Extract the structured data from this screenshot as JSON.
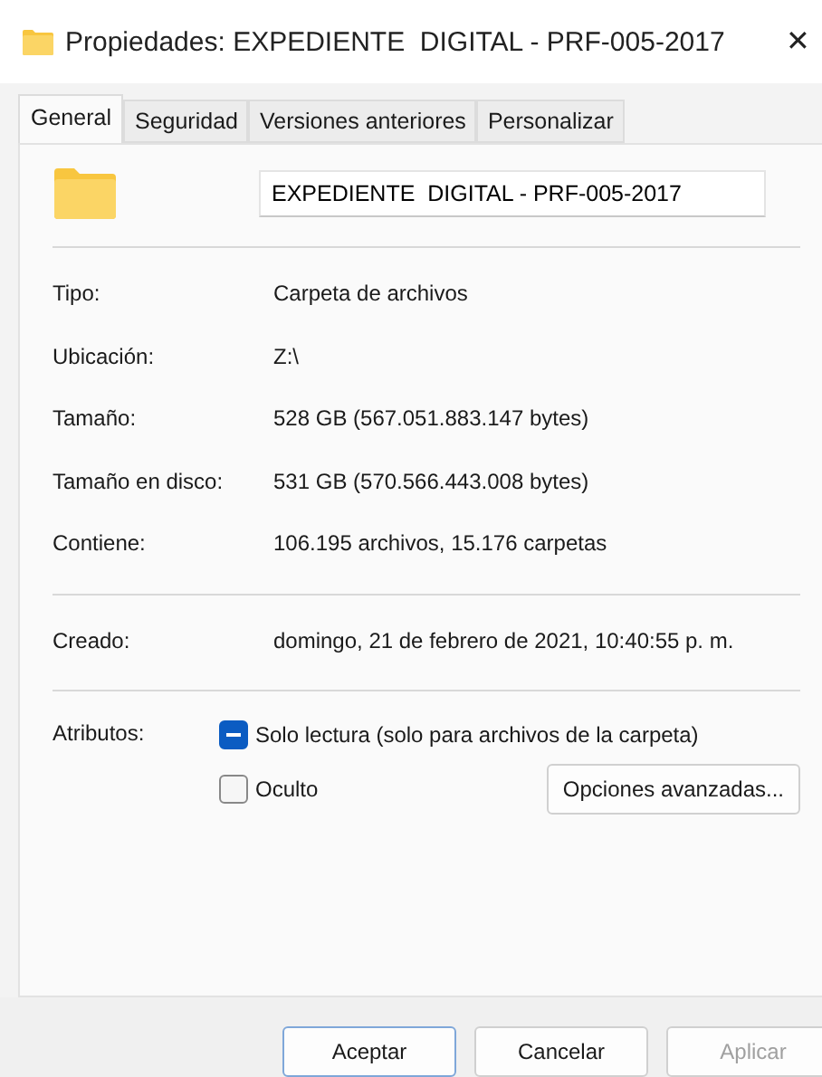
{
  "window": {
    "title": "Propiedades: EXPEDIENTE  DIGITAL - PRF-005-2017",
    "close": "✕"
  },
  "tabs": [
    {
      "label": "General",
      "selected": true
    },
    {
      "label": "Seguridad",
      "selected": false
    },
    {
      "label": "Versiones anteriores",
      "selected": false
    },
    {
      "label": "Personalizar",
      "selected": false
    }
  ],
  "name_field": {
    "value": "EXPEDIENTE  DIGITAL - PRF-005-2017"
  },
  "groups": [
    [
      {
        "label": "Tipo:",
        "value": "Carpeta de archivos"
      },
      {
        "label": "Ubicación:",
        "value": "Z:\\"
      },
      {
        "label": "Tamaño:",
        "value": "528 GB (567.051.883.147 bytes)"
      },
      {
        "label": "Tamaño en disco:",
        "value": "531 GB (570.566.443.008 bytes)"
      },
      {
        "label": "Contiene:",
        "value": "106.195 archivos, 15.176 carpetas"
      }
    ],
    [
      {
        "label": "Creado:",
        "value": "domingo, 21 de febrero de 2021, 10:40:55 p. m."
      }
    ]
  ],
  "attributes": {
    "label": "Atributos:",
    "items": [
      {
        "label": "Solo lectura (solo para archivos de la carpeta)",
        "checked": true,
        "mixed": true
      },
      {
        "label": "Oculto",
        "checked": false
      }
    ],
    "advanced": "Opciones avanzadas..."
  },
  "buttons": [
    {
      "label": "Aceptar",
      "disabled": false,
      "default": true
    },
    {
      "label": "Cancelar",
      "disabled": false,
      "default": false
    },
    {
      "label": "Aplicar",
      "disabled": true,
      "default": false
    }
  ]
}
